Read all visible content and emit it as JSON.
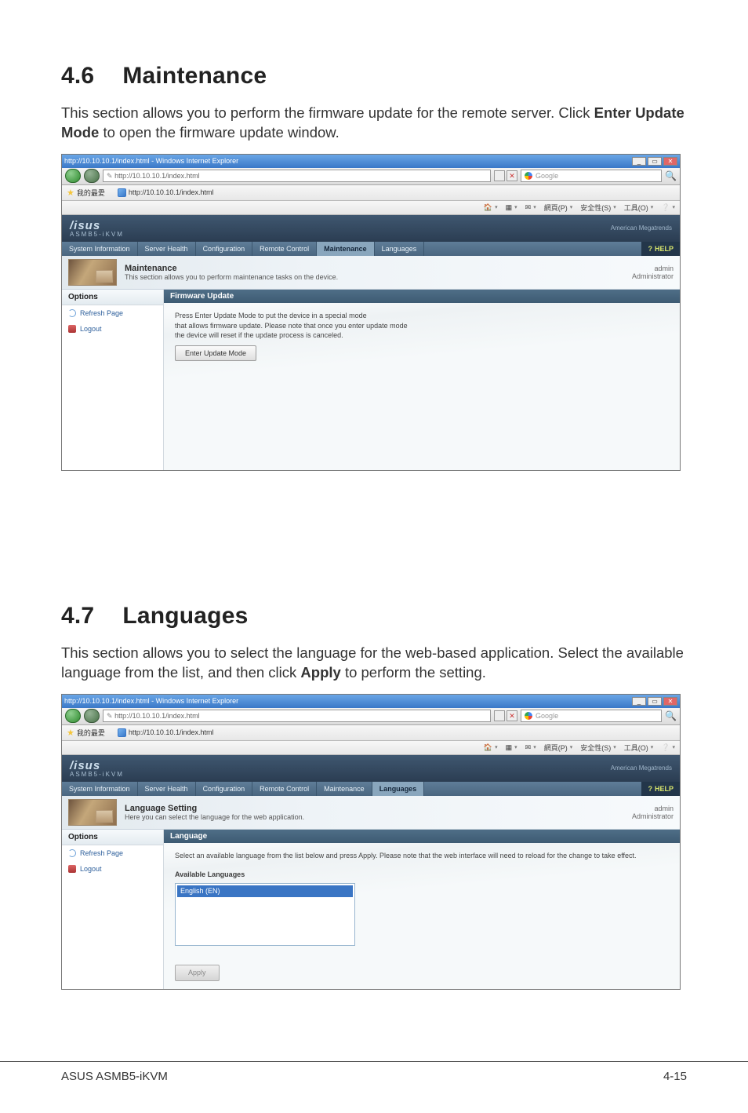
{
  "sections": {
    "s46": {
      "num": "4.6",
      "title": "Maintenance",
      "para_pre": "This section allows you to perform the firmware update for the remote server. Click ",
      "para_bold": "Enter Update Mode",
      "para_post": " to open the firmware update window."
    },
    "s47": {
      "num": "4.7",
      "title": "Languages",
      "para_pre": "This section allows you to select the language for the web-based application. Select the available language from the list, and then click ",
      "para_bold": "Apply",
      "para_post": " to perform the setting."
    }
  },
  "browser": {
    "window_title": "http://10.10.10.1/index.html - Windows Internet Explorer",
    "address": "http://10.10.10.1/index.html",
    "search_placeholder": "Google",
    "fav_label": "我的最愛",
    "tab_label": "http://10.10.10.1/index.html",
    "cmds": [
      "網頁(P)",
      "安全性(S)",
      "工具(O)"
    ]
  },
  "asus": {
    "brand": "/isus",
    "sub": "ASMB5-iKVM",
    "board": "American Megatrends",
    "nav": {
      "items": [
        "System Information",
        "Server Health",
        "Configuration",
        "Remote Control",
        "Maintenance",
        "Languages"
      ],
      "help": "HELP"
    },
    "user": "admin",
    "role": "Administrator",
    "sidebar": {
      "header": "Options",
      "refresh": "Refresh Page",
      "logout": "Logout"
    }
  },
  "shot_maint": {
    "hdr_title": "Maintenance",
    "hdr_sub": "This section allows you to perform maintenance tasks on the device.",
    "pane_title": "Firmware Update",
    "body_l1": "Press Enter Update Mode to put the device in a special mode",
    "body_l2": "that allows firmware update. Please note that once you enter update mode",
    "body_l3": "the device will reset if the update process is canceled.",
    "button": "Enter Update Mode"
  },
  "shot_lang": {
    "hdr_title": "Language Setting",
    "hdr_sub": "Here you can select the language for the web application.",
    "pane_title": "Language",
    "instruction": "Select an available language from the list below and press Apply. Please note that the web interface will need to reload for the change to take effect.",
    "list_label": "Available Languages",
    "selected": "English (EN)",
    "apply": "Apply"
  },
  "footer": {
    "left": "ASUS ASMB5-iKVM",
    "right": "4-15"
  }
}
